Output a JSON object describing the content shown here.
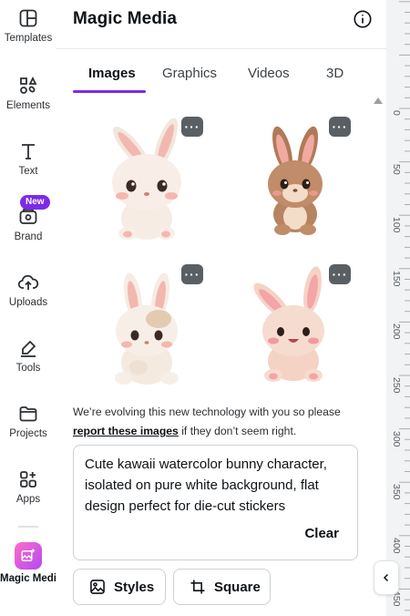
{
  "rail": {
    "items": [
      {
        "label": "Templates",
        "icon": "layout-icon"
      },
      {
        "label": "Elements",
        "icon": "shapes-icon"
      },
      {
        "label": "Text",
        "icon": "text-icon"
      },
      {
        "label": "Brand",
        "icon": "brand-icon",
        "badge": "New"
      },
      {
        "label": "Uploads",
        "icon": "cloud-upload-icon"
      },
      {
        "label": "Tools",
        "icon": "pen-icon"
      },
      {
        "label": "Projects",
        "icon": "folder-icon"
      },
      {
        "label": "Apps",
        "icon": "apps-icon"
      },
      {
        "label": "Magic Media",
        "icon": "magic-media-icon",
        "active": true
      }
    ]
  },
  "panel": {
    "title": "Magic Media",
    "tabs": [
      {
        "label": "Images",
        "active": true
      },
      {
        "label": "Graphics"
      },
      {
        "label": "Videos"
      },
      {
        "label": "3D"
      }
    ],
    "results": [
      {
        "alt": "bunny-sticker-1"
      },
      {
        "alt": "bunny-sticker-2"
      },
      {
        "alt": "bunny-sticker-3"
      },
      {
        "alt": "bunny-sticker-4"
      }
    ],
    "notice": {
      "before": "We’re evolving this new technology with you so please ",
      "link": "report these images",
      "after": " if they don’t seem right."
    },
    "prompt": {
      "text": "Cute kawaii watercolor bunny character, isolated on pure white background, flat design perfect for die-cut stickers",
      "clear_label": "Clear"
    },
    "styles_label": "Styles",
    "aspect_label": "Square"
  },
  "ruler": {
    "labels": [
      "0",
      "50",
      "100",
      "150",
      "200",
      "250",
      "300",
      "350",
      "400",
      "450"
    ]
  },
  "colors": {
    "accent": "#7d2ae8",
    "more_button": "#5a5f64",
    "ruler_bg": "#f2f3f5"
  }
}
